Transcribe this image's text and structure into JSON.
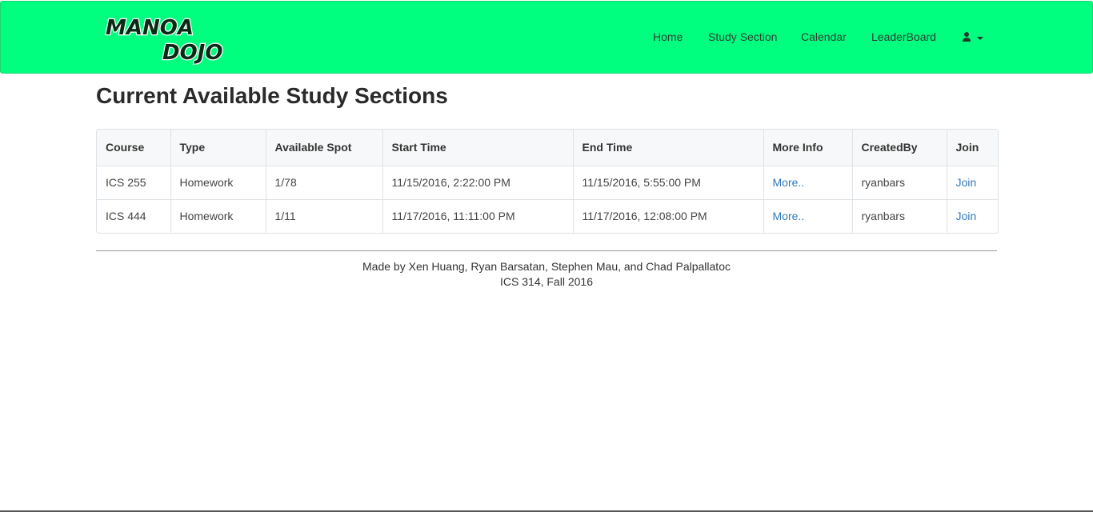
{
  "brand": {
    "logo_line1": "MANOA",
    "logo_line2": "DOJO",
    "color": "#00ff7f"
  },
  "nav": {
    "items": [
      {
        "label": "Home"
      },
      {
        "label": "Study Section"
      },
      {
        "label": "Calendar"
      },
      {
        "label": "LeaderBoard"
      }
    ],
    "user_icon": "user-icon",
    "dropdown_icon": "caret-down-icon"
  },
  "page": {
    "title": "Current Available Study Sections"
  },
  "table": {
    "headers": [
      "Course",
      "Type",
      "Available Spot",
      "Start Time",
      "End Time",
      "More Info",
      "CreatedBy",
      "Join"
    ],
    "rows": [
      {
        "course": "ICS 255",
        "type": "Homework",
        "spot": "1/78",
        "start": "11/15/2016, 2:22:00 PM",
        "end": "11/15/2016, 5:55:00 PM",
        "more": "More..",
        "created_by": "ryanbars",
        "join": "Join"
      },
      {
        "course": "ICS 444",
        "type": "Homework",
        "spot": "1/11",
        "start": "11/17/2016, 11:11:00 PM",
        "end": "11/17/2016, 12:08:00 PM",
        "more": "More..",
        "created_by": "ryanbars",
        "join": "Join"
      }
    ]
  },
  "footer": {
    "line1": "Made by Xen Huang, Ryan Barsatan, Stephen Mau, and Chad Palpallatoc",
    "line2": "ICS 314, Fall 2016"
  },
  "colors": {
    "navbar": "#00ff7f",
    "link": "#337ab7"
  }
}
